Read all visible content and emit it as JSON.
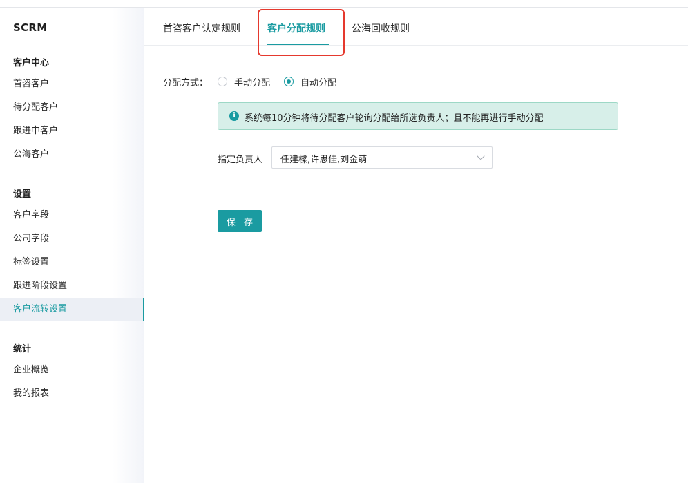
{
  "app": {
    "brand": "SCRM"
  },
  "sidebar": {
    "sections": [
      {
        "title": "客户中心",
        "items": [
          "首咨客户",
          "待分配客户",
          "跟进中客户",
          "公海客户"
        ]
      },
      {
        "title": "设置",
        "items": [
          "客户字段",
          "公司字段",
          "标签设置",
          "跟进阶段设置",
          "客户流转设置"
        ]
      },
      {
        "title": "统计",
        "items": [
          "企业概览",
          "我的报表"
        ]
      }
    ],
    "active_item": "客户流转设置"
  },
  "tabs": [
    {
      "label": "首咨客户认定规则",
      "active": false
    },
    {
      "label": "客户分配规则",
      "active": true
    },
    {
      "label": "公海回收规则",
      "active": false
    }
  ],
  "form": {
    "method_label": "分配方式：",
    "options": [
      {
        "label": "手动分配",
        "checked": false
      },
      {
        "label": "自动分配",
        "checked": true
      }
    ],
    "alert": {
      "icon": "info-icon",
      "text": "系统每10分钟将待分配客户轮询分配给所选负责人；且不能再进行手动分配"
    },
    "owner_label": "指定负责人",
    "owner_value": "任建樑,许思佳,刘金萌",
    "save_label": "保 存"
  },
  "colors": {
    "accent": "#1a9ba1",
    "highlight": "#e5392e",
    "alert_bg": "#d7efe9"
  }
}
